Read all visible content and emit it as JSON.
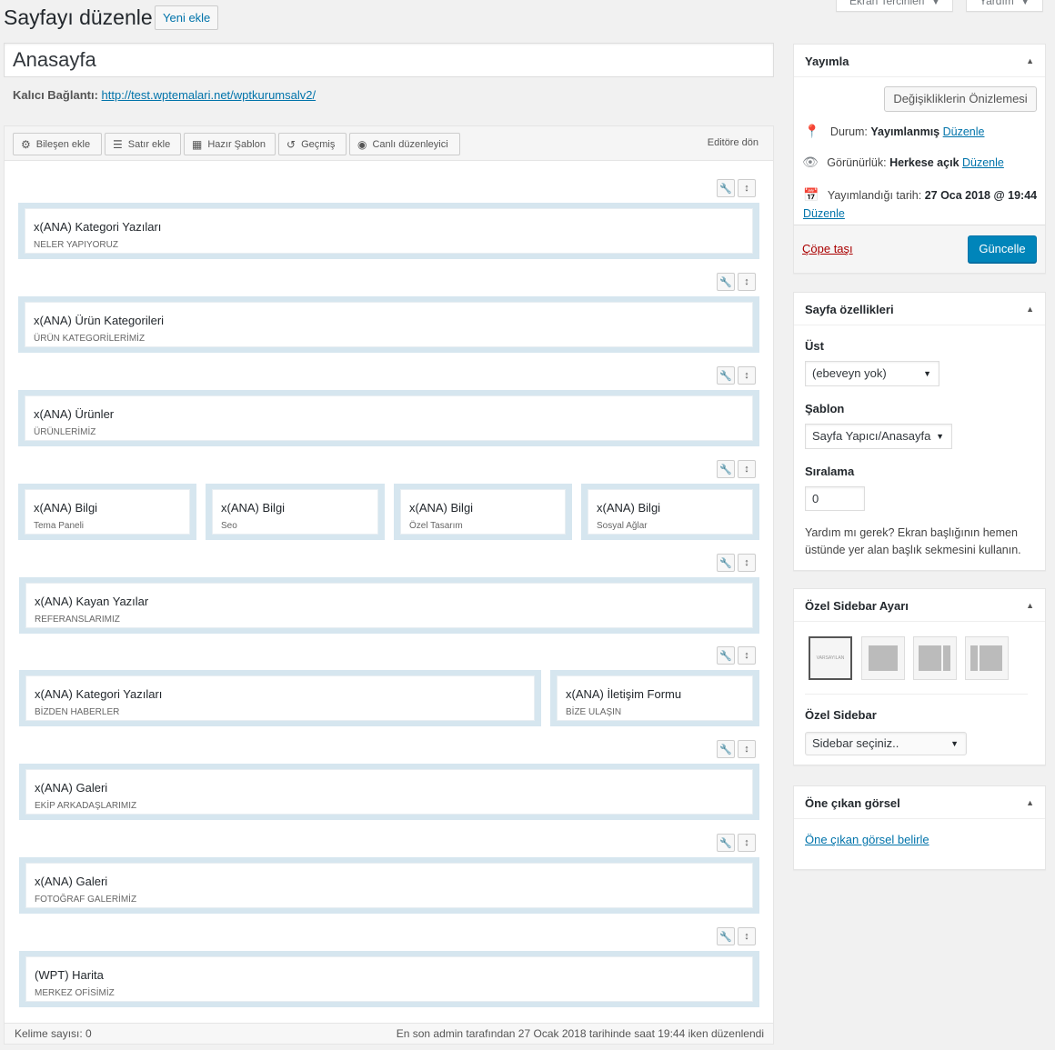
{
  "header": {
    "title": "Sayfayı düzenle",
    "add_new": "Yeni ekle",
    "screen_options": "Ekran Tercihleri",
    "help": "Yardım"
  },
  "post": {
    "title": "Anasayfa",
    "permalink_label": "Kalıcı Bağlantı:",
    "permalink_url": "http://test.wptemalari.net/wptkurumsalv2/"
  },
  "builder": {
    "toolbar": {
      "add_widget": "Bileşen ekle",
      "add_row": "Satır ekle",
      "prebuilt": "Hazır Şablon",
      "history": "Geçmiş",
      "live_editor": "Canlı düzenleyici",
      "back_to_editor": "Editöre dön"
    },
    "rows": [
      {
        "cells": [
          {
            "title": "x(ANA) Kategori Yazıları",
            "sub": "NELER YAPIYORUZ"
          }
        ]
      },
      {
        "cells": [
          {
            "title": "x(ANA) Ürün Kategorileri",
            "sub": "ÜRÜN KATEGORİLERİMİZ"
          }
        ]
      },
      {
        "cells": [
          {
            "title": "x(ANA) Ürünler",
            "sub": "ÜRÜNLERİMİZ"
          }
        ]
      },
      {
        "cells": [
          {
            "title": "x(ANA) Bilgi",
            "sub": "Tema Paneli"
          },
          {
            "title": "x(ANA) Bilgi",
            "sub": "Seo"
          },
          {
            "title": "x(ANA) Bilgi",
            "sub": "Özel Tasarım"
          },
          {
            "title": "x(ANA) Bilgi",
            "sub": "Sosyal Ağlar"
          }
        ]
      },
      {
        "cells": [
          {
            "title": "x(ANA) Kayan Yazılar",
            "sub": "REFERANSLARIMIZ"
          }
        ]
      },
      {
        "cells": [
          {
            "title": "x(ANA) Kategori Yazıları",
            "sub": "BİZDEN HABERLER"
          },
          {
            "title": "x(ANA) İletişim Formu",
            "sub": "BİZE ULAŞIN"
          }
        ]
      },
      {
        "cells": [
          {
            "title": "x(ANA) Galeri",
            "sub": "EKİP ARKADAŞLARIMIZ"
          }
        ]
      },
      {
        "cells": [
          {
            "title": "x(ANA) Galeri",
            "sub": "FOTOĞRAF GALERİMİZ"
          }
        ]
      },
      {
        "cells": [
          {
            "title": "(WPT) Harita",
            "sub": "MERKEZ OFİSİMİZ"
          }
        ]
      }
    ]
  },
  "status_bar": {
    "word_count": "Kelime sayısı: 0",
    "last_edit": "En son admin tarafından 27 Ocak 2018 tarihinde saat 19:44 iken düzenlendi"
  },
  "publish": {
    "title": "Yayımla",
    "preview": "Değişikliklerin Önizlemesi",
    "status_label": "Durum:",
    "status_value": "Yayımlanmış",
    "visibility_label": "Görünürlük:",
    "visibility_value": "Herkese açık",
    "date_label": "Yayımlandığı tarih:",
    "date_value": "27 Oca 2018 @ 19:44",
    "edit": "Düzenle",
    "trash": "Çöpe taşı",
    "update": "Güncelle"
  },
  "page_attributes": {
    "title": "Sayfa özellikleri",
    "parent_label": "Üst",
    "parent_value": "(ebeveyn yok)",
    "template_label": "Şablon",
    "template_value": "Sayfa Yapıcı/Anasayfa",
    "order_label": "Sıralama",
    "order_value": "0",
    "help": "Yardım mı gerek? Ekran başlığının hemen üstünde yer alan başlık sekmesini kullanın."
  },
  "sidebar_settings": {
    "title": "Özel Sidebar Ayarı",
    "default_thumb": "VARSAYILAN",
    "label": "Özel Sidebar",
    "select_value": "Sidebar seçiniz.."
  },
  "featured_image": {
    "title": "Öne çıkan görsel",
    "set_link": "Öne çıkan görsel belirle"
  },
  "colors": {
    "accent": "#0085ba",
    "link": "#0073aa",
    "trash": "#a00",
    "row_bg": "#d6e6ef"
  }
}
